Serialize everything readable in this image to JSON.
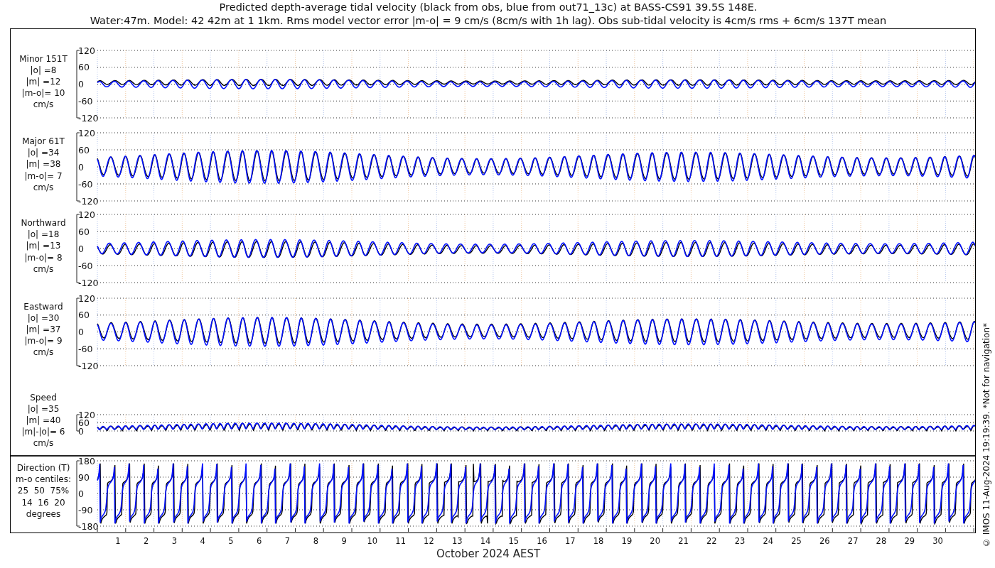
{
  "title_lines": [
    "Predicted depth-average tidal velocity (black from obs, blue from out71_13c) at BASS-CS91 39.5S 148E.",
    "Water:47m. Model: 42 42m at 1 1km. Rms model vector error |m-o| = 9 cm/s (8cm/s with 1h lag). Obs sub-tidal velocity is 4cm/s rms + 6cm/s 137T mean"
  ],
  "panels": [
    {
      "kind": "signed",
      "label_lines": [
        "Minor 151T",
        "|o| =8",
        "|m| =12",
        "|m-o|= 10",
        "cm/s"
      ],
      "yticks": [
        "120",
        "60",
        "0",
        "-60",
        "-120"
      ]
    },
    {
      "kind": "signed",
      "label_lines": [
        "Major 61T",
        "|o| =34",
        "|m| =38",
        "|m-o|= 7",
        "cm/s"
      ],
      "yticks": [
        "120",
        "60",
        "0",
        "-60",
        "-120"
      ]
    },
    {
      "kind": "signed",
      "label_lines": [
        "Northward",
        "|o| =18",
        "|m| =13",
        "|m-o|= 8",
        "cm/s"
      ],
      "yticks": [
        "120",
        "60",
        "0",
        "-60",
        "-120"
      ]
    },
    {
      "kind": "signed",
      "label_lines": [
        "Eastward",
        "|o| =30",
        "|m| =37",
        "|m-o|= 9",
        "cm/s"
      ],
      "yticks": [
        "120",
        "60",
        "0",
        "-60",
        "-120"
      ]
    },
    {
      "kind": "speed",
      "label_lines": [
        "Speed",
        "|o| =35",
        "|m| =40",
        "|m|-|o|= 6",
        "cm/s"
      ],
      "yticks": [
        "120",
        "60",
        "0"
      ]
    },
    {
      "kind": "direction",
      "label_lines": [
        "Direction (T)",
        "m-o centiles:",
        "25  50  75%",
        "14  16  20",
        "degrees"
      ],
      "yticks": [
        "180",
        "90",
        "0",
        "-90",
        "-180"
      ]
    }
  ],
  "x_labels": [
    "1",
    "2",
    "3",
    "4",
    "5",
    "6",
    "7",
    "8",
    "9",
    "10",
    "11",
    "12",
    "13",
    "14",
    "15",
    "16",
    "17",
    "18",
    "19",
    "20",
    "21",
    "22",
    "23",
    "24",
    "25",
    "26",
    "27",
    "28",
    "29",
    "30"
  ],
  "xlabel": "October 2024 AEST",
  "side_note": "© IMOS 11-Aug-2024 19:19:39. *Not for navigation*"
}
